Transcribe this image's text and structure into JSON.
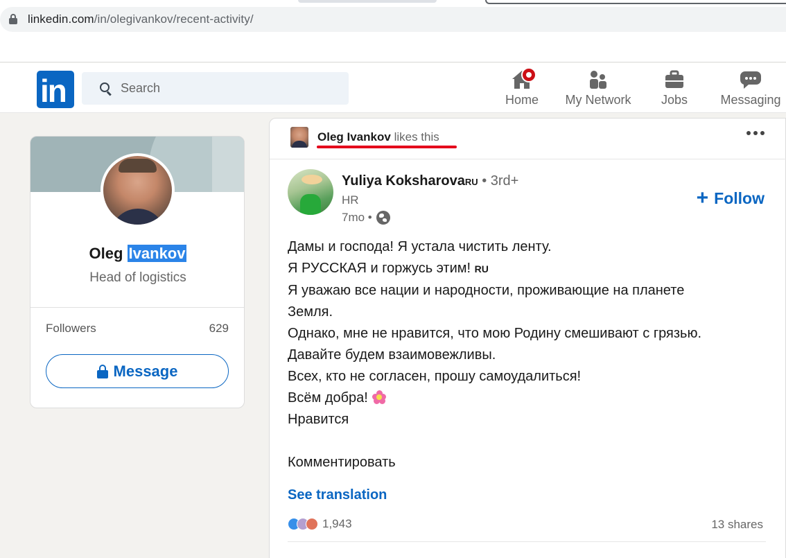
{
  "browser": {
    "url_domain": "linkedin.com",
    "url_path": "/in/olegivankov/recent-activity/"
  },
  "header": {
    "search_placeholder": "Search",
    "nav": [
      {
        "label": "Home",
        "icon": "home-icon"
      },
      {
        "label": "My Network",
        "icon": "network-icon"
      },
      {
        "label": "Jobs",
        "icon": "briefcase-icon"
      },
      {
        "label": "Messaging",
        "icon": "messaging-icon"
      }
    ],
    "logo_text": "in"
  },
  "profile": {
    "first_name": "Oleg",
    "last_name": "Ivankov",
    "headline": "Head of logistics",
    "followers_label": "Followers",
    "followers_count": "629",
    "message_label": "Message"
  },
  "post": {
    "activity_name": "Oleg Ivankov",
    "activity_verb": "likes this",
    "author_name": "Yuliya Koksharova",
    "author_flag": "RU",
    "author_degree": "• 3rd+",
    "author_title": "HR",
    "author_time": "7mo •",
    "follow_label": "Follow",
    "body_lines": [
      "Дамы и господа! Я устала чистить ленту.",
      "Я РУССКАЯ и горжусь этим!",
      "RU",
      "Я уважаю все нации и народности, проживающие на планете",
      "Земля.",
      "Однако, мне не нравится, что мою Родину смешивают с грязью.",
      "Давайте будем взаимовежливы.",
      "Всех, кто не согласен, прошу самоудалиться!",
      "Всём добра!",
      "Нравится",
      "Комментировать"
    ],
    "see_translation": "See translation",
    "reactions_count": "1,943",
    "shares": "13 shares"
  },
  "colors": {
    "brand": "#0a66c2",
    "notification": "#cc1016",
    "highlight": "#2b84e8",
    "annotation": "#e4001b"
  }
}
